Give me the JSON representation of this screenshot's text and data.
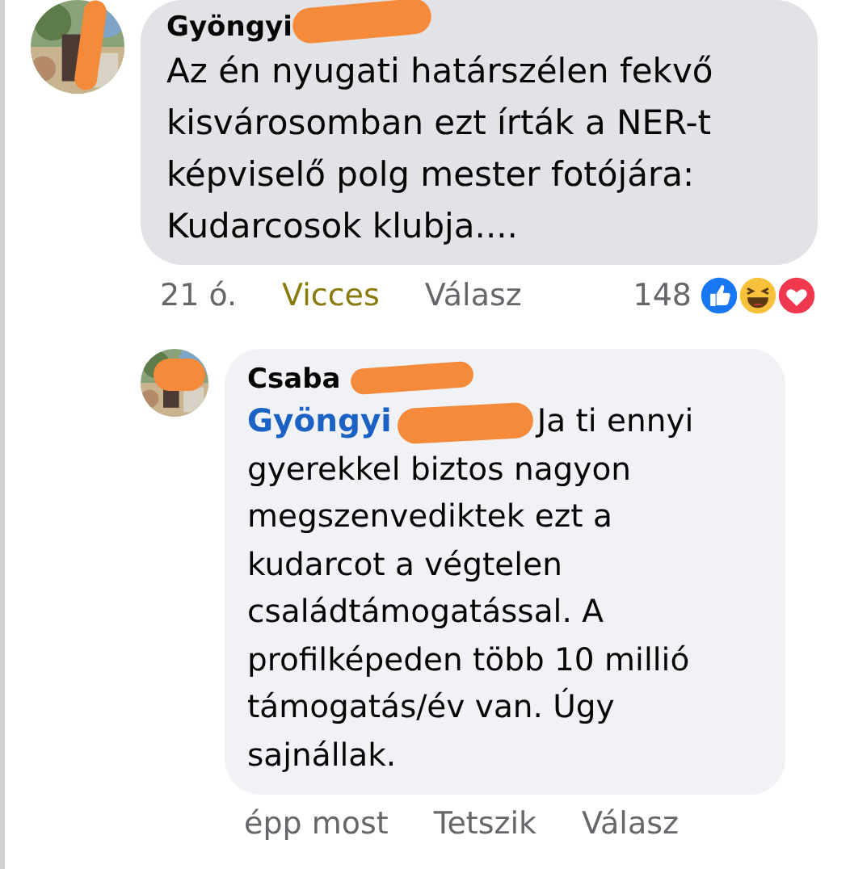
{
  "comments": [
    {
      "author": "Gyöngyi",
      "author_redacted": true,
      "avatar_redacted": true,
      "text": "Az én nyugati határszélen fekvő kisvárosomban ezt írták a NER-t képviselő polg mester fotójára: Kudarcosok klubja....",
      "time": "21 ó.",
      "actions": [
        {
          "label": "Vicces",
          "selected": true
        },
        {
          "label": "Válasz",
          "selected": false
        }
      ],
      "reaction_count": "148",
      "reactions": [
        {
          "kind": "like"
        },
        {
          "kind": "haha"
        },
        {
          "kind": "love"
        }
      ],
      "replies": [
        {
          "author": "Csaba",
          "author_redacted": true,
          "avatar_redacted": true,
          "mention": "Gyöngyi",
          "mention_redacted": true,
          "text": "Ja ti ennyi gyerekkel biztos nagyon megszenvediktek ezt a kudarcot a végtelen családtámogatással. A profilképeden több 10 millió támogatás/év van. Úgy sajnállak.",
          "time": "épp most",
          "actions": [
            {
              "label": "Tetszik",
              "selected": false
            },
            {
              "label": "Válasz",
              "selected": false
            }
          ]
        }
      ]
    }
  ]
}
